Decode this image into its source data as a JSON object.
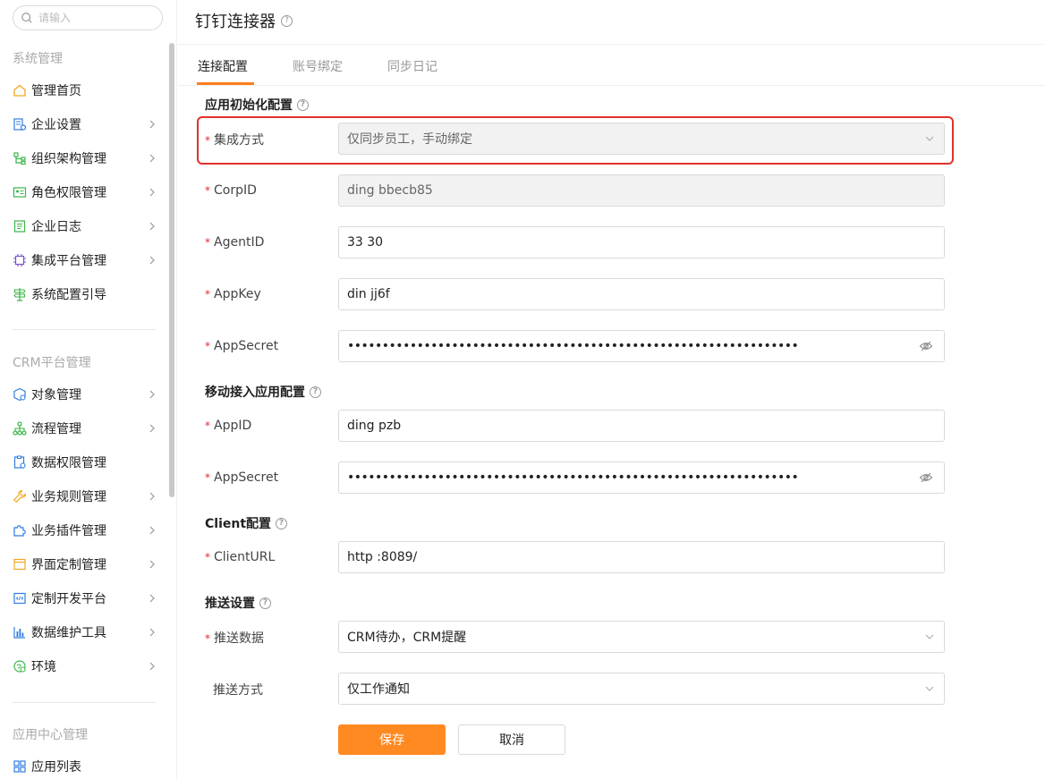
{
  "sidebar": {
    "search_placeholder": "请输入",
    "sections": [
      {
        "title": "系统管理"
      },
      {
        "title": "CRM平台管理"
      },
      {
        "title": "应用中心管理"
      }
    ],
    "items": [
      {
        "label": "管理首页",
        "icon": "home-icon",
        "chevron": false
      },
      {
        "label": "企业设置",
        "icon": "enterprise-settings-icon",
        "chevron": true
      },
      {
        "label": "组织架构管理",
        "icon": "org-structure-icon",
        "chevron": true
      },
      {
        "label": "角色权限管理",
        "icon": "role-card-icon",
        "chevron": true
      },
      {
        "label": "企业日志",
        "icon": "log-icon",
        "chevron": true
      },
      {
        "label": "集成平台管理",
        "icon": "chip-icon",
        "chevron": true
      },
      {
        "label": "系统配置引导",
        "icon": "signpost-icon",
        "chevron": false
      },
      {
        "label": "对象管理",
        "icon": "object-icon",
        "chevron": true
      },
      {
        "label": "流程管理",
        "icon": "flow-icon",
        "chevron": true
      },
      {
        "label": "数据权限管理",
        "icon": "data-permission-icon",
        "chevron": false
      },
      {
        "label": "业务规则管理",
        "icon": "wrench-icon",
        "chevron": true
      },
      {
        "label": "业务插件管理",
        "icon": "puzzle-icon",
        "chevron": true
      },
      {
        "label": "界面定制管理",
        "icon": "layout-icon",
        "chevron": true
      },
      {
        "label": "定制开发平台",
        "icon": "code-icon",
        "chevron": true
      },
      {
        "label": "数据维护工具",
        "icon": "bar-chart-icon",
        "chevron": true
      },
      {
        "label": "环境",
        "icon": "environment-icon",
        "chevron": true
      },
      {
        "label": "应用列表",
        "icon": "grid-icon",
        "chevron": false
      }
    ]
  },
  "header": {
    "title": "钉钉连接器",
    "help": "?"
  },
  "tabs": [
    {
      "label": "连接配置",
      "active": true
    },
    {
      "label": "账号绑定",
      "active": false
    },
    {
      "label": "同步日记",
      "active": false
    }
  ],
  "groups": {
    "app_init": "应用初始化配置",
    "mobile": "移动接入应用配置",
    "client": "Client配置",
    "push": "推送设置"
  },
  "fields": {
    "integration_mode": {
      "label": "集成方式",
      "value": "仅同步员工，手动绑定"
    },
    "corp_id": {
      "label": "CorpID",
      "value": "ding          bbecb85"
    },
    "agent_id": {
      "label": "AgentID",
      "value": "33        30"
    },
    "app_key": {
      "label": "AppKey",
      "value": "din        jj6f"
    },
    "app_secret": {
      "label": "AppSecret",
      "value": "•••••••••••••••••••••••••••••••••••••••••••••••••••••••••••••••••"
    },
    "app_id": {
      "label": "AppID",
      "value": "ding             pzb"
    },
    "app_secret_mobile": {
      "label": "AppSecret",
      "value": "•••••••••••••••••••••••••••••••••••••••••••••••••••••••••••••••••"
    },
    "client_url": {
      "label": "ClientURL",
      "value": "http         :8089/"
    },
    "push_data": {
      "label": "推送数据",
      "value": "CRM待办，CRM提醒"
    },
    "push_method": {
      "label": "推送方式",
      "value": "仅工作通知"
    }
  },
  "buttons": {
    "save": "保存",
    "cancel": "取消"
  },
  "colors": {
    "accent": "#ff8a22",
    "tab_underline": "#ff7d1a",
    "required": "#f5222d",
    "highlight_box": "#e23128"
  }
}
